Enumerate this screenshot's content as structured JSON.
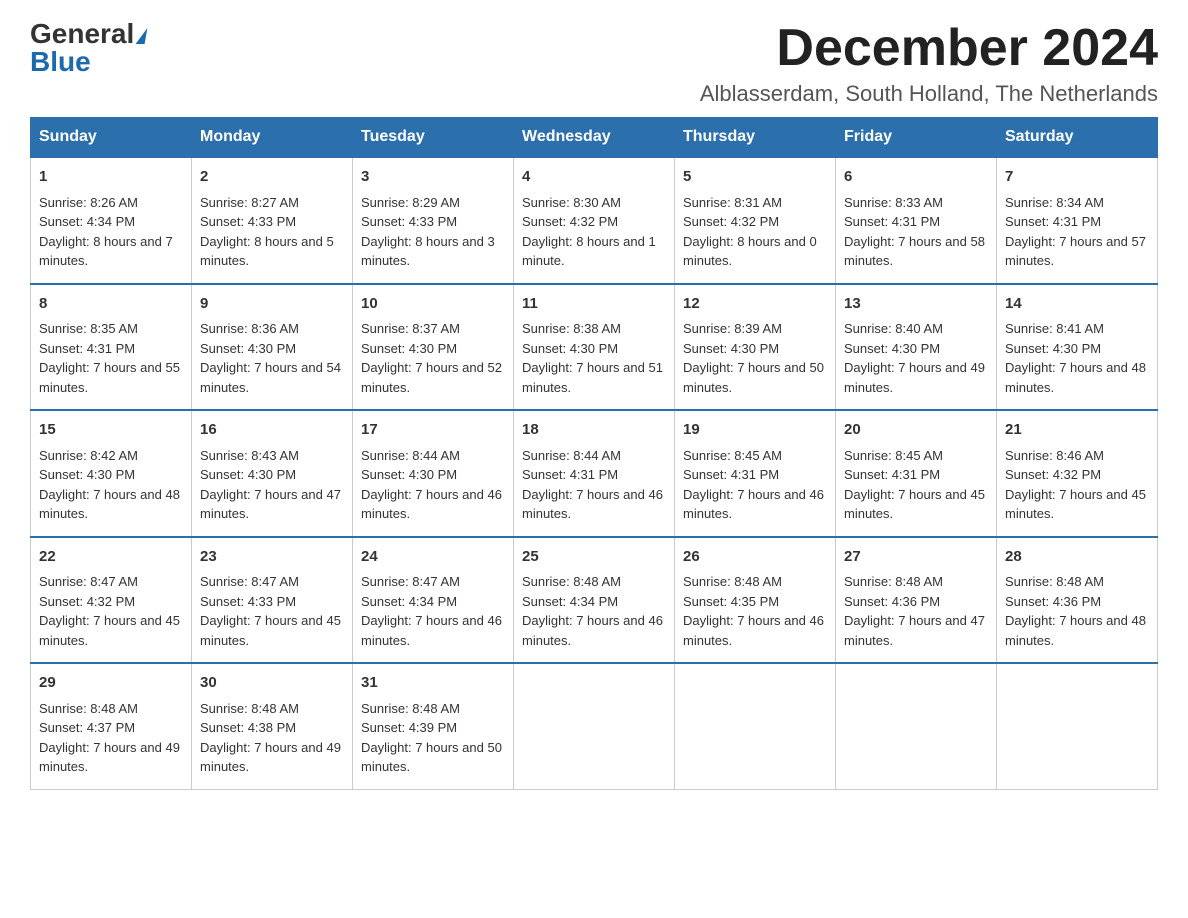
{
  "header": {
    "logo_line1": "General",
    "logo_line2": "Blue",
    "month_title": "December 2024",
    "subtitle": "Alblasserdam, South Holland, The Netherlands"
  },
  "days_of_week": [
    "Sunday",
    "Monday",
    "Tuesday",
    "Wednesday",
    "Thursday",
    "Friday",
    "Saturday"
  ],
  "weeks": [
    [
      {
        "day": "1",
        "sunrise": "8:26 AM",
        "sunset": "4:34 PM",
        "daylight": "8 hours and 7 minutes."
      },
      {
        "day": "2",
        "sunrise": "8:27 AM",
        "sunset": "4:33 PM",
        "daylight": "8 hours and 5 minutes."
      },
      {
        "day": "3",
        "sunrise": "8:29 AM",
        "sunset": "4:33 PM",
        "daylight": "8 hours and 3 minutes."
      },
      {
        "day": "4",
        "sunrise": "8:30 AM",
        "sunset": "4:32 PM",
        "daylight": "8 hours and 1 minute."
      },
      {
        "day": "5",
        "sunrise": "8:31 AM",
        "sunset": "4:32 PM",
        "daylight": "8 hours and 0 minutes."
      },
      {
        "day": "6",
        "sunrise": "8:33 AM",
        "sunset": "4:31 PM",
        "daylight": "7 hours and 58 minutes."
      },
      {
        "day": "7",
        "sunrise": "8:34 AM",
        "sunset": "4:31 PM",
        "daylight": "7 hours and 57 minutes."
      }
    ],
    [
      {
        "day": "8",
        "sunrise": "8:35 AM",
        "sunset": "4:31 PM",
        "daylight": "7 hours and 55 minutes."
      },
      {
        "day": "9",
        "sunrise": "8:36 AM",
        "sunset": "4:30 PM",
        "daylight": "7 hours and 54 minutes."
      },
      {
        "day": "10",
        "sunrise": "8:37 AM",
        "sunset": "4:30 PM",
        "daylight": "7 hours and 52 minutes."
      },
      {
        "day": "11",
        "sunrise": "8:38 AM",
        "sunset": "4:30 PM",
        "daylight": "7 hours and 51 minutes."
      },
      {
        "day": "12",
        "sunrise": "8:39 AM",
        "sunset": "4:30 PM",
        "daylight": "7 hours and 50 minutes."
      },
      {
        "day": "13",
        "sunrise": "8:40 AM",
        "sunset": "4:30 PM",
        "daylight": "7 hours and 49 minutes."
      },
      {
        "day": "14",
        "sunrise": "8:41 AM",
        "sunset": "4:30 PM",
        "daylight": "7 hours and 48 minutes."
      }
    ],
    [
      {
        "day": "15",
        "sunrise": "8:42 AM",
        "sunset": "4:30 PM",
        "daylight": "7 hours and 48 minutes."
      },
      {
        "day": "16",
        "sunrise": "8:43 AM",
        "sunset": "4:30 PM",
        "daylight": "7 hours and 47 minutes."
      },
      {
        "day": "17",
        "sunrise": "8:44 AM",
        "sunset": "4:30 PM",
        "daylight": "7 hours and 46 minutes."
      },
      {
        "day": "18",
        "sunrise": "8:44 AM",
        "sunset": "4:31 PM",
        "daylight": "7 hours and 46 minutes."
      },
      {
        "day": "19",
        "sunrise": "8:45 AM",
        "sunset": "4:31 PM",
        "daylight": "7 hours and 46 minutes."
      },
      {
        "day": "20",
        "sunrise": "8:45 AM",
        "sunset": "4:31 PM",
        "daylight": "7 hours and 45 minutes."
      },
      {
        "day": "21",
        "sunrise": "8:46 AM",
        "sunset": "4:32 PM",
        "daylight": "7 hours and 45 minutes."
      }
    ],
    [
      {
        "day": "22",
        "sunrise": "8:47 AM",
        "sunset": "4:32 PM",
        "daylight": "7 hours and 45 minutes."
      },
      {
        "day": "23",
        "sunrise": "8:47 AM",
        "sunset": "4:33 PM",
        "daylight": "7 hours and 45 minutes."
      },
      {
        "day": "24",
        "sunrise": "8:47 AM",
        "sunset": "4:34 PM",
        "daylight": "7 hours and 46 minutes."
      },
      {
        "day": "25",
        "sunrise": "8:48 AM",
        "sunset": "4:34 PM",
        "daylight": "7 hours and 46 minutes."
      },
      {
        "day": "26",
        "sunrise": "8:48 AM",
        "sunset": "4:35 PM",
        "daylight": "7 hours and 46 minutes."
      },
      {
        "day": "27",
        "sunrise": "8:48 AM",
        "sunset": "4:36 PM",
        "daylight": "7 hours and 47 minutes."
      },
      {
        "day": "28",
        "sunrise": "8:48 AM",
        "sunset": "4:36 PM",
        "daylight": "7 hours and 48 minutes."
      }
    ],
    [
      {
        "day": "29",
        "sunrise": "8:48 AM",
        "sunset": "4:37 PM",
        "daylight": "7 hours and 49 minutes."
      },
      {
        "day": "30",
        "sunrise": "8:48 AM",
        "sunset": "4:38 PM",
        "daylight": "7 hours and 49 minutes."
      },
      {
        "day": "31",
        "sunrise": "8:48 AM",
        "sunset": "4:39 PM",
        "daylight": "7 hours and 50 minutes."
      },
      null,
      null,
      null,
      null
    ]
  ]
}
